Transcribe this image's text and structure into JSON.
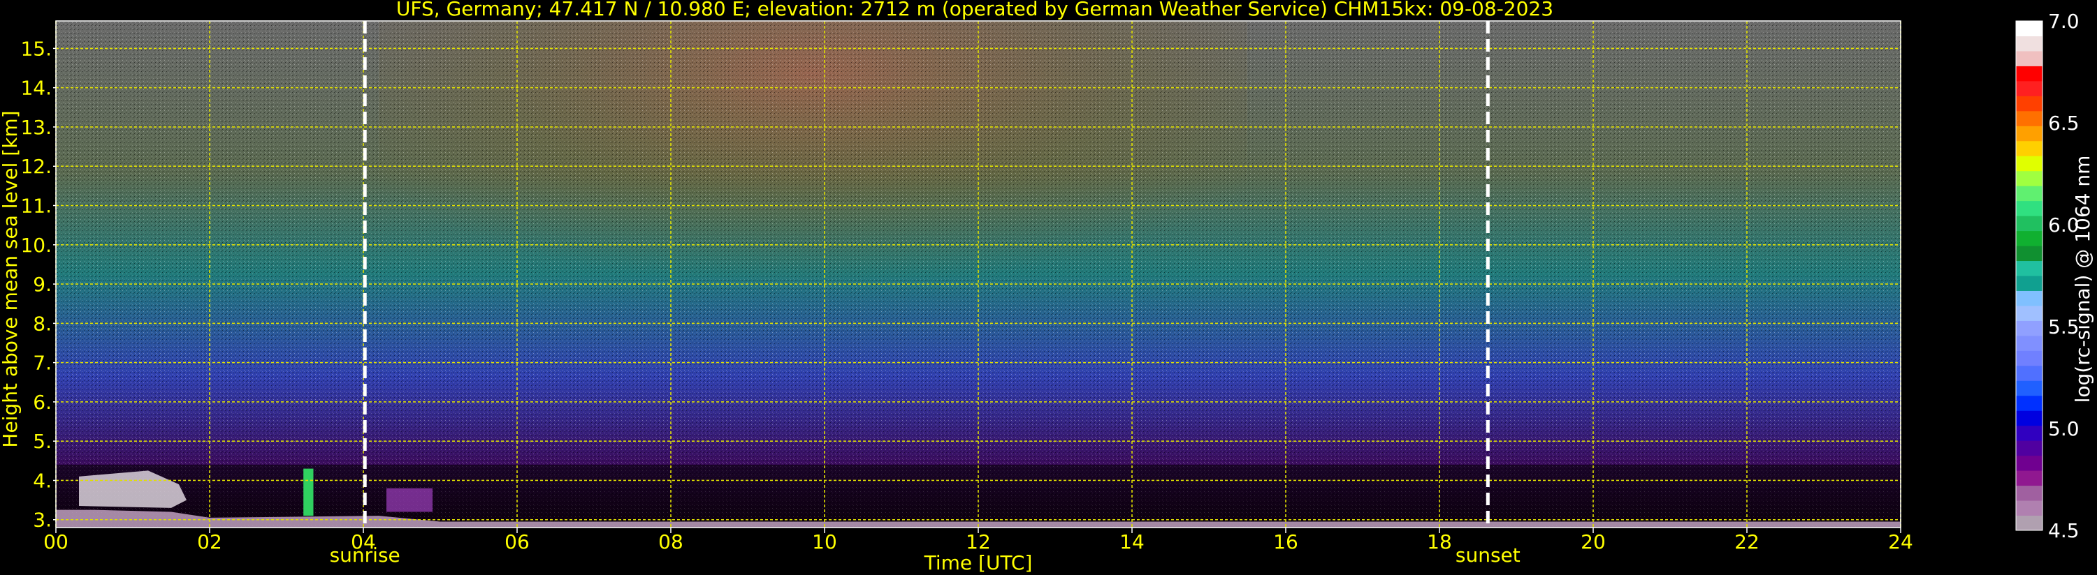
{
  "chart_data": {
    "type": "heatmap",
    "title": "UFS, Germany; 47.417 N / 10.980 E; elevation: 2712 m  (operated by German Weather Service)     CHM15kx: 09-08-2023",
    "xlabel": "Time [UTC]",
    "ylabel": "Height above mean sea level [km]",
    "xlim": [
      0,
      24
    ],
    "ylim": [
      2.8,
      15.7
    ],
    "x_ticks": [
      0,
      2,
      4,
      6,
      8,
      10,
      12,
      14,
      16,
      18,
      20,
      22,
      24
    ],
    "x_tick_labels": [
      "00",
      "02",
      "04",
      "06",
      "08",
      "10",
      "12",
      "14",
      "16",
      "18",
      "20",
      "22",
      "24"
    ],
    "y_ticks": [
      3,
      4,
      5,
      6,
      7,
      8,
      9,
      10,
      11,
      12,
      13,
      14,
      15
    ],
    "y_tick_labels": [
      "3.",
      "4.",
      "5.",
      "6.",
      "7.",
      "8.",
      "9.",
      "10.",
      "11.",
      "12.",
      "13.",
      "14.",
      "15."
    ],
    "grid": true,
    "markers": [
      {
        "label": "sunrise",
        "x": 4.02
      },
      {
        "label": "sunset",
        "x": 18.63
      }
    ],
    "colorbar": {
      "label": "log(rc-signal) @ 1064 nm",
      "min": 4.5,
      "max": 7.0,
      "ticks": [
        4.5,
        5.0,
        5.5,
        6.0,
        6.5,
        7.0
      ],
      "tick_labels": [
        "4.5",
        "5.0",
        "5.5",
        "6.0",
        "6.5",
        "7.0"
      ],
      "colors": [
        "#b0a0b0",
        "#b080b0",
        "#a060a0",
        "#901890",
        "#700090",
        "#5000a0",
        "#3000c0",
        "#0000e0",
        "#0030ff",
        "#2060ff",
        "#5070ff",
        "#7080ff",
        "#8090ff",
        "#90a0ff",
        "#a0c0ff",
        "#80c0ff",
        "#10a090",
        "#20c0a0",
        "#109030",
        "#10b030",
        "#20c060",
        "#30e080",
        "#60f070",
        "#a0ff40",
        "#e0ff00",
        "#ffd000",
        "#ffa000",
        "#ff7000",
        "#ff4000",
        "#ff2020",
        "#ff0000",
        "#f0c0c0",
        "#f0e0e0",
        "#ffffff"
      ]
    }
  }
}
